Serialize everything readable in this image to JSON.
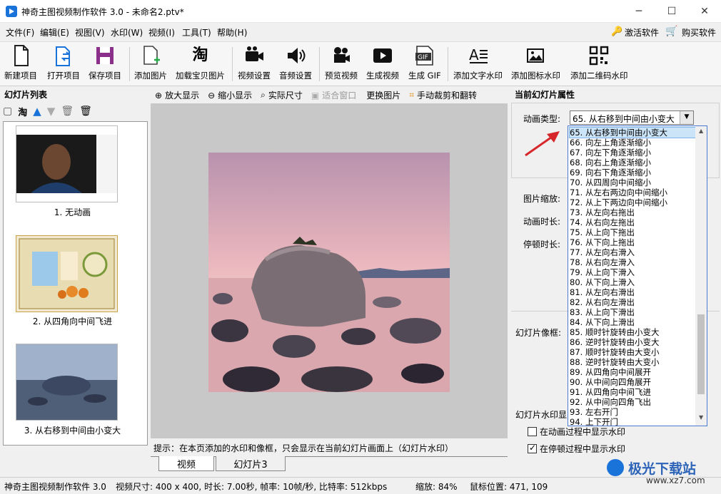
{
  "window": {
    "title": "神奇主图视频制作软件 3.0 - 未命名2.ptv*",
    "minimize": "─",
    "maximize": "☐",
    "close": "✕"
  },
  "menu": [
    "文件(F)",
    "编辑(E)",
    "视图(V)",
    "水印(W)",
    "视频(I)",
    "工具(T)",
    "帮助(H)"
  ],
  "menu_right": {
    "activate": "激活软件",
    "buy": "购买软件"
  },
  "toolbar": [
    {
      "label": "新建项目",
      "icon": "new-file-icon"
    },
    {
      "label": "打开项目",
      "icon": "open-file-icon"
    },
    {
      "label": "保存项目",
      "icon": "save-icon"
    },
    {
      "label": "添加图片",
      "icon": "add-image-icon"
    },
    {
      "label": "加载宝贝图片",
      "icon": "taobao-icon"
    },
    {
      "label": "视频设置",
      "icon": "video-camera-icon"
    },
    {
      "label": "音频设置",
      "icon": "speaker-icon"
    },
    {
      "label": "预览视频",
      "icon": "movie-camera-icon"
    },
    {
      "label": "生成视频",
      "icon": "play-video-icon"
    },
    {
      "label": "生成 GIF",
      "icon": "gif-icon"
    },
    {
      "label": "添加文字水印",
      "icon": "text-watermark-icon"
    },
    {
      "label": "添加图标水印",
      "icon": "image-watermark-icon"
    },
    {
      "label": "添加二维码水印",
      "icon": "qrcode-icon"
    }
  ],
  "slides_panel": {
    "title": "幻灯片列表",
    "taobao_glyph": "淘"
  },
  "slides": [
    {
      "label": "1. 无动画"
    },
    {
      "label": "2. 从四角向中间飞进"
    },
    {
      "label": "3. 从右移到中间由小变大"
    }
  ],
  "view_toolbar": {
    "zoom_in": "放大显示",
    "zoom_out": "缩小显示",
    "actual": "实际尺寸",
    "fit": "适合窗口",
    "replace": "更换图片",
    "crop": "手动裁剪和翻转"
  },
  "hint": "提示：在本页添加的水印和像框，只会显示在当前幻灯片画面上（幻灯片水印）",
  "tabs": [
    "视频",
    "幻灯片3"
  ],
  "props": {
    "title": "当前幻灯片属性",
    "anim_type_label": "动画类型:",
    "anim_type_value": "65. 从右移到中间由小变大",
    "scale_label": "图片缩放:",
    "duration_label": "动画时长:",
    "pause_label": "停顿时长:",
    "frame_label": "幻灯片像框:",
    "watermark_label": "幻灯片水印显",
    "chk_anim": "在动画过程中显示水印",
    "chk_pause": "在停顿过程中显示水印",
    "chk_anim_checked": false,
    "chk_pause_checked": true
  },
  "dropdown_items": [
    "65. 从右移到中间由小变大",
    "66. 向左上角逐渐缩小",
    "67. 向左下角逐渐缩小",
    "68. 向右上角逐渐缩小",
    "69. 向右下角逐渐缩小",
    "70. 从四周向中间缩小",
    "71. 从左右两边向中间缩小",
    "72. 从上下两边向中间缩小",
    "73. 从左向右拖出",
    "74. 从右向左拖出",
    "75. 从上向下拖出",
    "76. 从下向上拖出",
    "77. 从左向右滑入",
    "78. 从右向左滑入",
    "79. 从上向下滑入",
    "80. 从下向上滑入",
    "81. 从左向右滑出",
    "82. 从右向左滑出",
    "83. 从上向下滑出",
    "84. 从下向上滑出",
    "85. 顺时针旋转由小变大",
    "86. 逆时针旋转由小变大",
    "87. 顺时针旋转由大变小",
    "88. 逆时针旋转由大变小",
    "89. 从四角向中间展开",
    "90. 从中间向四角展开",
    "91. 从四角向中间飞进",
    "92. 从中间向四角飞出",
    "93. 左右开门",
    "94. 上下开门"
  ],
  "status": {
    "app": "神奇主图视频制作软件 3.0",
    "info": "视频尺寸: 400 x 400, 时长: 7.00秒, 帧率: 10帧/秒, 比特率: 512kbps",
    "zoom": "缩放: 84%",
    "mouse": "鼠标位置: 471, 109"
  },
  "watermark_site": "极光下载站",
  "watermark_url": "www.xz7.com",
  "colors": {
    "accent": "#1a73d9",
    "selection": "#cce4f7",
    "arrow": "#d6262a"
  }
}
